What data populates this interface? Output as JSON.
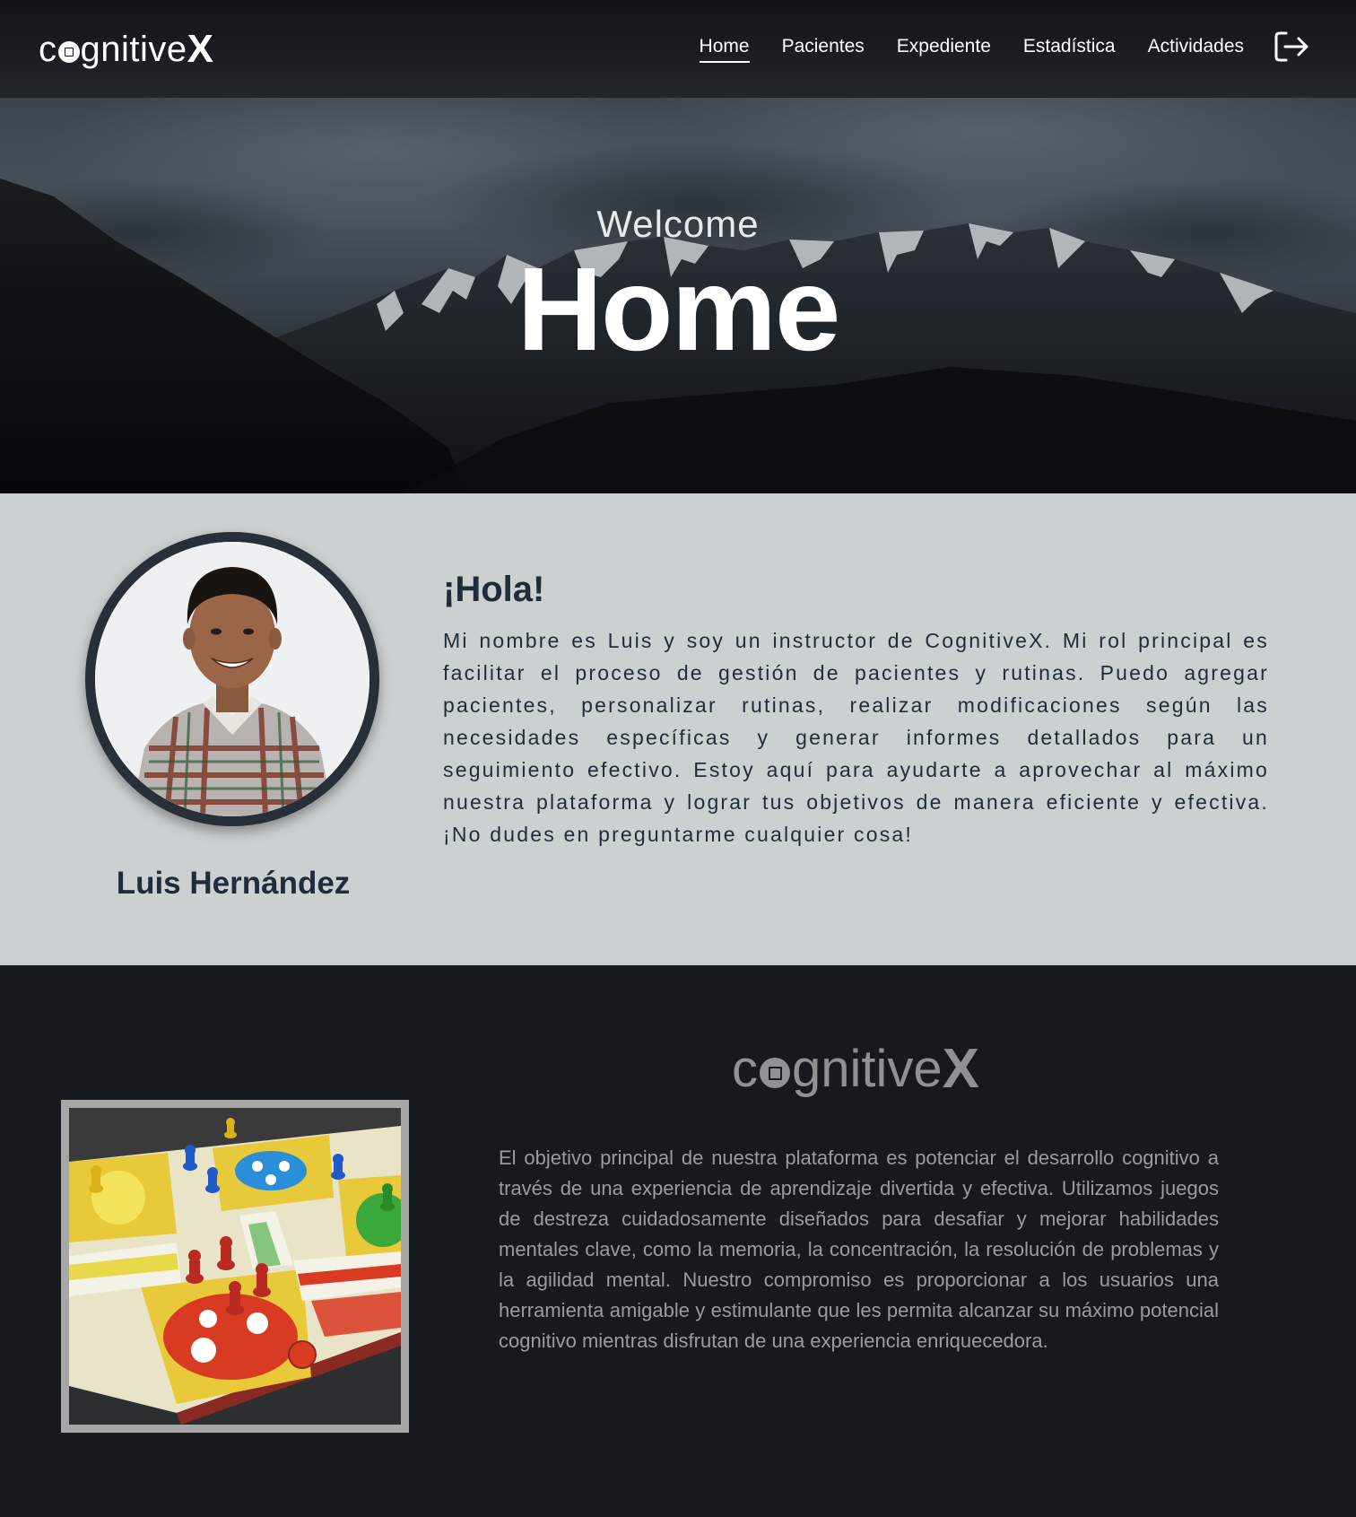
{
  "navbar": {
    "logo": {
      "prefix": "c",
      "middle": "gnitive",
      "suffix": "X"
    },
    "links": [
      {
        "label": "Home",
        "active": true
      },
      {
        "label": "Pacientes",
        "active": false
      },
      {
        "label": "Expediente",
        "active": false
      },
      {
        "label": "Estadística",
        "active": false
      },
      {
        "label": "Actividades",
        "active": false
      }
    ],
    "logout_icon": "logout-icon"
  },
  "hero": {
    "subtitle": "Welcome",
    "title": "Home"
  },
  "about": {
    "name": "Luis Hernández",
    "greeting": "¡Hola!",
    "bio": "Mi nombre es Luis y soy un instructor de CognitiveX. Mi rol principal es facilitar el proceso de gestión de pacientes y rutinas. Puedo agregar pacientes, personalizar rutinas, realizar modificaciones según las necesidades específicas y generar informes detallados para un seguimiento efectivo. Estoy aquí para ayudarte a aprovechar al máximo nuestra plataforma y lograr tus objetivos de manera eficiente y efectiva. ¡No dudes en preguntarme cualquier cosa!"
  },
  "mission": {
    "logo": {
      "prefix": "c",
      "middle": "gnitive",
      "suffix": "X"
    },
    "text": "El objetivo principal de nuestra plataforma es potenciar el desarrollo cognitivo a través de una experiencia de aprendizaje divertida y efectiva. Utilizamos juegos de destreza cuidadosamente diseñados para desafiar y mejorar habilidades mentales clave, como la memoria, la concentración, la resolución de problemas y la agilidad mental. Nuestro compromiso es proporcionar a los usuarios una herramienta amigable y estimulante que les permita alcanzar su máximo potencial cognitivo mientras disfrutan de una experiencia enriquecedora."
  },
  "colors": {
    "navbar_bg": "#1b1e22",
    "about_bg": "#cbd0d1",
    "text_dark": "#1f2d3b",
    "mission_bg": "#161a1f",
    "mission_text": "#9a9c9e"
  }
}
